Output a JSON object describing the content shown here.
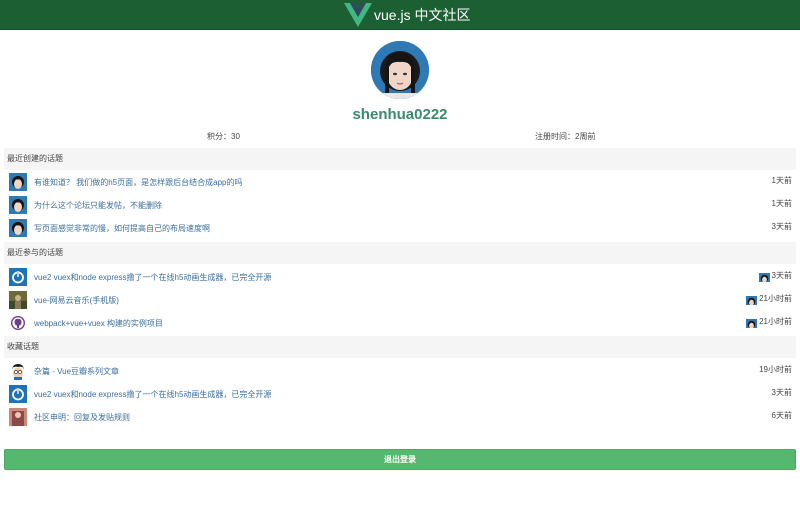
{
  "header": {
    "brand": "vue.js 中文社区"
  },
  "profile": {
    "username": "shenhua0222",
    "score": "积分：30",
    "registered": "注册时间：2周前"
  },
  "sections": {
    "created": {
      "title": "最近创建的话题",
      "items": [
        {
          "title": "有谁知道？ 我们做的h5页面，是怎样跟后台结合成app的吗",
          "time": "1天前",
          "avatar": "user-photo-avatar"
        },
        {
          "title": "为什么这个论坛只能发帖，不能删除",
          "time": "1天前",
          "avatar": "user-photo-avatar"
        },
        {
          "title": "写页面感觉非常的慢，如何提高自己的布局速度啊",
          "time": "3天前",
          "avatar": "user-photo-avatar"
        }
      ]
    },
    "joined": {
      "title": "最近参与的话题",
      "items": [
        {
          "title": "vue2 vuex和node express撸了一个在线h5动画生成器，已完全开源",
          "time": "3天前",
          "avatar": "power-icon"
        },
        {
          "title": "vue-网易云音乐(手机版)",
          "time": "21小时前",
          "avatar": "photo-avatar"
        },
        {
          "title": "webpack+vue+vuex 构建的实例项目",
          "time": "21小时前",
          "avatar": "github-icon"
        }
      ]
    },
    "favorites": {
      "title": "收藏话题",
      "items": [
        {
          "title": "杂篇 - Vue豆瓣系列文章",
          "time": "19小时前",
          "avatar": "cartoon-avatar"
        },
        {
          "title": "vue2 vuex和node express撸了一个在线h5动画生成器，已完全开源",
          "time": "3天前",
          "avatar": "power-icon"
        },
        {
          "title": "社区申明：回复及发贴规则",
          "time": "6天前",
          "avatar": "photo-avatar"
        }
      ]
    }
  },
  "logout": {
    "label": "退出登录"
  },
  "colors": {
    "topbar": "#1c5f33",
    "username": "#3a8a6b",
    "link": "#3b6f9c",
    "logout": "#56b86e",
    "section_bg": "#f5f5f5"
  }
}
